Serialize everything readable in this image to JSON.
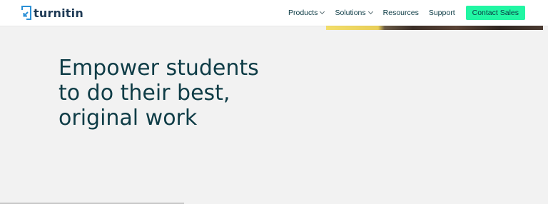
{
  "brand": {
    "name": "turnitin",
    "icon": "turnitin-logo-icon"
  },
  "nav": {
    "items": [
      {
        "label": "Products",
        "has_dropdown": true
      },
      {
        "label": "Solutions",
        "has_dropdown": true
      },
      {
        "label": "Resources",
        "has_dropdown": false
      },
      {
        "label": "Support",
        "has_dropdown": false
      }
    ],
    "cta_label": "Contact Sales"
  },
  "hero": {
    "headline_lines": [
      "Empower students",
      "to do their best,",
      "original work"
    ]
  },
  "colors": {
    "header_bg": "#ffffff",
    "page_bg": "#f2f2f2",
    "text_dark": "#0e3c46",
    "cta_bg": "#21f6a3",
    "logo_blue": "#2a8fd6"
  }
}
